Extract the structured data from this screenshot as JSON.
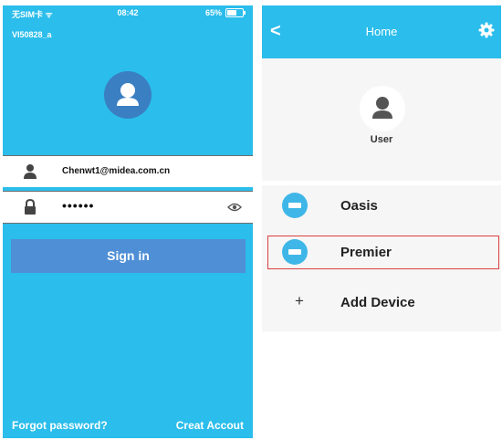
{
  "left": {
    "status": {
      "carrier": "无SIM卡 ᯤ",
      "time": "08:42",
      "battery": "65%",
      "battery_level": 0.65
    },
    "device_id": "VI50828_a",
    "username": "Chenwt1@midea.com.cn",
    "password": "••••••",
    "signin_label": "Sign in",
    "forgot_label": "Forgot password?",
    "create_label": "Creat Accout"
  },
  "right": {
    "title": "Home",
    "back_glyph": "<",
    "user_label": "User",
    "devices": [
      {
        "name": "Oasis",
        "icon": "ac-icon"
      },
      {
        "name": "Premier",
        "icon": "ac-icon",
        "highlighted": true
      }
    ],
    "add_label": "Add Device",
    "add_glyph": "+"
  },
  "colors": {
    "accent": "#2bbdeb",
    "button": "#4f8fd6",
    "avatar": "#3a7fc2",
    "highlight": "#d94040"
  }
}
